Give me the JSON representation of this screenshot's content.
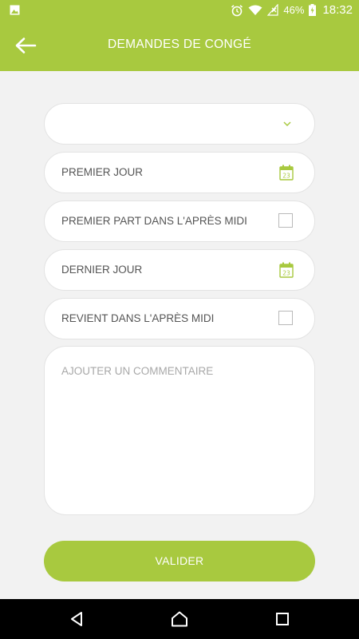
{
  "status_bar": {
    "battery": "46%",
    "time": "18:32",
    "icons": [
      "image-icon",
      "alarm-icon",
      "wifi-icon",
      "no-signal-icon",
      "battery-charging-icon"
    ]
  },
  "app_bar": {
    "title": "DEMANDES DE CONGÉ",
    "back_icon": "arrow-left-icon"
  },
  "form": {
    "type_select": {
      "value": "",
      "icon": "chevron-down-icon"
    },
    "first_day": {
      "label": "PREMIER JOUR",
      "icon": "calendar-icon",
      "calendar_day": "23"
    },
    "first_afternoon": {
      "label": "PREMIER PART DANS L'APRÈS MIDI",
      "checked": false
    },
    "last_day": {
      "label": "DERNIER JOUR",
      "icon": "calendar-icon",
      "calendar_day": "23"
    },
    "return_afternoon": {
      "label": "REVIENT DANS L'APRÈS MIDI",
      "checked": false
    },
    "comment": {
      "placeholder": "AJOUTER UN COMMENTAIRE",
      "value": ""
    },
    "submit_label": "VALIDER"
  },
  "nav_bar": {
    "icons": [
      "back-triangle-icon",
      "home-icon",
      "recents-icon"
    ]
  },
  "colors": {
    "accent": "#a8c93f",
    "background": "#f2f2f2",
    "field_bg": "#ffffff",
    "label_text": "#555555",
    "placeholder_text": "#a8a8a8"
  }
}
